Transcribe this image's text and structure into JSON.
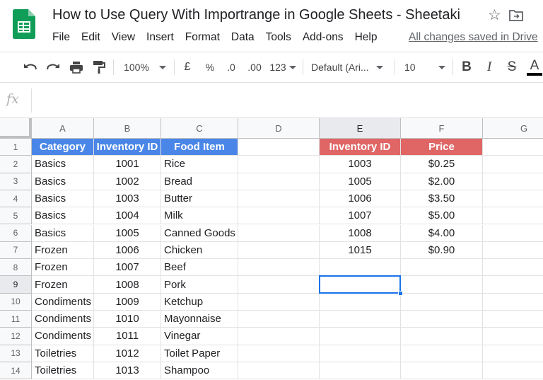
{
  "title_bar": {
    "doc_title": "How to Use Query With Importrange in Google Sheets - Sheetaki",
    "star_icon": "star-outline-icon",
    "move_icon": "move-to-folder-icon",
    "save_status": "All changes saved in Drive"
  },
  "menu": [
    "File",
    "Edit",
    "View",
    "Insert",
    "Format",
    "Data",
    "Tools",
    "Add-ons",
    "Help"
  ],
  "toolbar": {
    "zoom": "100%",
    "currency": "£",
    "percent": "%",
    "decrease_decimals": ".0",
    "increase_decimals": ".00",
    "number_format": "123",
    "font": "Default (Ari...",
    "font_size": "10",
    "bold": "B",
    "italic": "I",
    "strikethrough": "S",
    "text_color": "A"
  },
  "formula_bar": {
    "fx_label": "fx",
    "value": ""
  },
  "columns": [
    "A",
    "B",
    "C",
    "D",
    "E",
    "F",
    "G"
  ],
  "rows": [
    "1",
    "2",
    "3",
    "4",
    "5",
    "6",
    "7",
    "8",
    "9",
    "10",
    "11",
    "12",
    "13",
    "14"
  ],
  "selected_cell": "E9",
  "colors": {
    "blue_header": "#4a86e8",
    "red_header": "#e06666",
    "selection": "#1a73e8",
    "logo_green": "#0f9d58"
  },
  "left_table": {
    "headers": [
      "Category",
      "Inventory ID",
      "Food Item"
    ],
    "rows": [
      [
        "Basics",
        "1001",
        "Rice"
      ],
      [
        "Basics",
        "1002",
        "Bread"
      ],
      [
        "Basics",
        "1003",
        "Butter"
      ],
      [
        "Basics",
        "1004",
        "Milk"
      ],
      [
        "Basics",
        "1005",
        "Canned Goods"
      ],
      [
        "Frozen",
        "1006",
        "Chicken"
      ],
      [
        "Frozen",
        "1007",
        "Beef"
      ],
      [
        "Frozen",
        "1008",
        "Pork"
      ],
      [
        "Condiments",
        "1009",
        "Ketchup"
      ],
      [
        "Condiments",
        "1010",
        "Mayonnaise"
      ],
      [
        "Condiments",
        "1011",
        "Vinegar"
      ],
      [
        "Toiletries",
        "1012",
        "Toilet Paper"
      ],
      [
        "Toiletries",
        "1013",
        "Shampoo"
      ]
    ]
  },
  "right_table": {
    "headers": [
      "Inventory ID",
      "Price"
    ],
    "rows": [
      [
        "1003",
        "$0.25"
      ],
      [
        "1005",
        "$2.00"
      ],
      [
        "1006",
        "$3.50"
      ],
      [
        "1007",
        "$5.00"
      ],
      [
        "1008",
        "$4.00"
      ],
      [
        "1015",
        "$0.90"
      ]
    ]
  }
}
